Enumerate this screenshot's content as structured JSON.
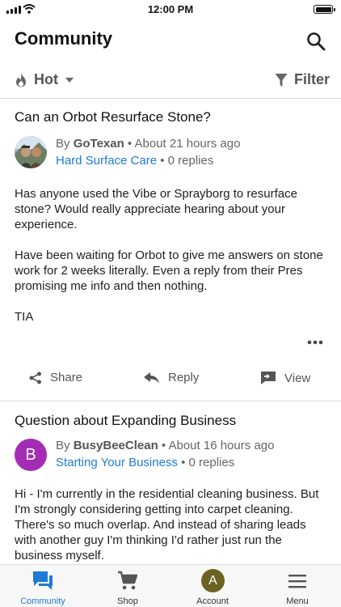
{
  "status_bar": {
    "time": "12:00 PM"
  },
  "header": {
    "title": "Community"
  },
  "toolbar": {
    "sort_label": "Hot",
    "filter_label": "Filter"
  },
  "posts": [
    {
      "title": "Can an Orbot Resurface Stone?",
      "by": "By",
      "author": "GoTexan",
      "time": " • About 21 hours ago",
      "category": "Hard Surface Care",
      "replies": " • 0 replies",
      "body": [
        "Has anyone used the Vibe or Sprayborg to resurface stone? Would really appreciate hearing about your experience.",
        "Have been waiting for Orbot to give me answers on stone work for 2 weeks literally. Even a reply from their Pres promising me info and then nothing.",
        "TIA"
      ],
      "actions": {
        "share": "Share",
        "reply": "Reply",
        "view": "View"
      }
    },
    {
      "title": "Question about Expanding Business",
      "avatar_letter": "B",
      "by": "By",
      "author": "BusyBeeClean",
      "time": " • About 16 hours ago",
      "category": "Starting Your Business",
      "replies": " • 0 replies",
      "body": [
        "Hi - I'm currently in the residential cleaning business. But I'm strongly considering getting into carpet cleaning. There's so much overlap. And instead of sharing leads with another guy I'm thinking I'd rather just run the business myself."
      ]
    }
  ],
  "tab_bar": {
    "items": [
      {
        "label": "Community",
        "icon": "chat-bubbles-icon",
        "active": true
      },
      {
        "label": "Shop",
        "icon": "cart-icon"
      },
      {
        "label": "Account",
        "avatar_letter": "A"
      },
      {
        "label": "Menu",
        "icon": "hamburger-icon"
      }
    ]
  },
  "colors": {
    "accent": "#1f7ad6",
    "avatar_b": "#a42cb5",
    "avatar_a": "#6b6121"
  }
}
